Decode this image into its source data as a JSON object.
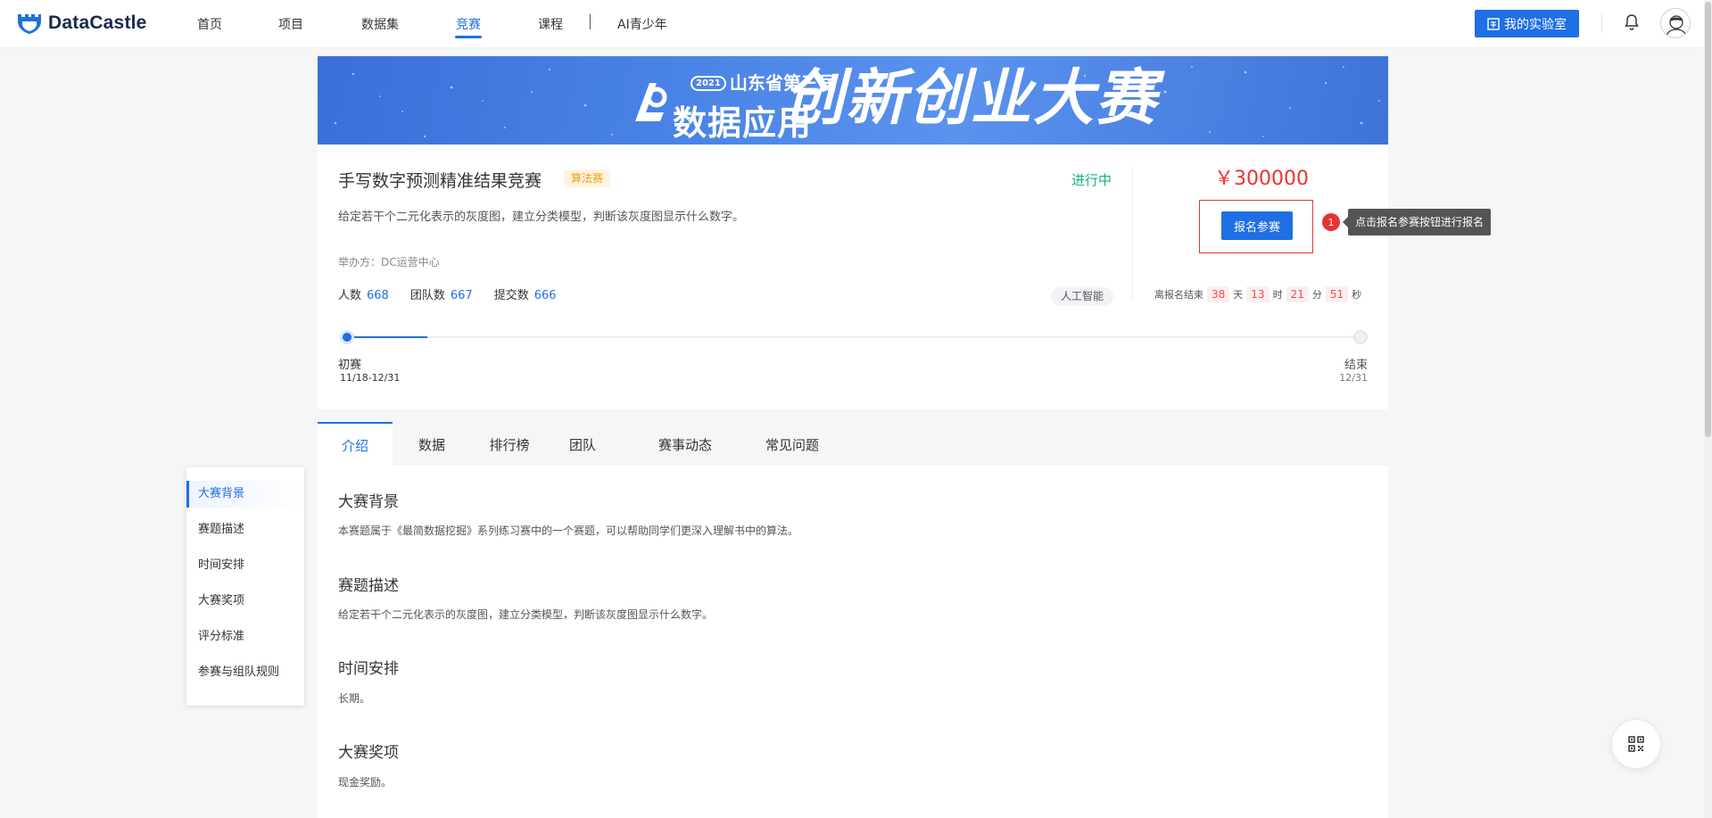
{
  "header": {
    "brand": "DataCastle",
    "nav": [
      {
        "label": "首页"
      },
      {
        "label": "项目"
      },
      {
        "label": "数据集"
      },
      {
        "label": "竞赛"
      },
      {
        "label": "课程"
      },
      {
        "label": "AI青少年"
      }
    ],
    "active_nav": "竞赛",
    "lab_button": "我的实验室"
  },
  "banner": {
    "year": "2021",
    "line1": "山东省第三届",
    "line2": "数据应用",
    "headline": "创新创业大赛"
  },
  "competition": {
    "title": "手写数字预测精准结果竞赛",
    "type_badge": "算法赛",
    "status": "进行中",
    "description": "给定若干个二元化表示的灰度图，建立分类模型，判断该灰度图显示什么数字。",
    "organizer": "举办方：DC运营中心",
    "stats": [
      {
        "label": "人数",
        "value": "668"
      },
      {
        "label": "团队数",
        "value": "667"
      },
      {
        "label": "提交数",
        "value": "666"
      }
    ],
    "tag": "人工智能",
    "prize": "￥300000",
    "signup_button": "报名参赛",
    "step_number": "1",
    "tooltip": "点击报名参赛按钮进行报名",
    "countdown": {
      "prefix": "离报名结束",
      "days": "38",
      "days_unit": "天",
      "hours": "13",
      "hours_unit": "时",
      "minutes": "21",
      "minutes_unit": "分",
      "seconds": "51",
      "seconds_unit": "秒"
    },
    "timeline": {
      "progress": 0.08,
      "start": {
        "name": "初赛",
        "date": "11/18-12/31"
      },
      "end": {
        "name": "结束",
        "date": "12/31"
      }
    }
  },
  "tabs": [
    {
      "label": "介绍"
    },
    {
      "label": "数据"
    },
    {
      "label": "排行榜"
    },
    {
      "label": "团队"
    },
    {
      "label": "赛事动态"
    },
    {
      "label": "常见问题"
    }
  ],
  "active_tab": "介绍",
  "side_nav": [
    {
      "label": "大赛背景"
    },
    {
      "label": "赛题描述"
    },
    {
      "label": "时间安排"
    },
    {
      "label": "大赛奖项"
    },
    {
      "label": "评分标准"
    },
    {
      "label": "参赛与组队规则"
    }
  ],
  "sections": [
    {
      "title": "大赛背景",
      "text": "本赛题属于《最简数据挖掘》系列练习赛中的一个赛题，可以帮助同学们更深入理解书中的算法。"
    },
    {
      "title": "赛题描述",
      "text": "给定若干个二元化表示的灰度图，建立分类模型，判断该灰度图显示什么数字。"
    },
    {
      "title": "时间安排",
      "text": "长期。"
    },
    {
      "title": "大赛奖项",
      "text": "现金奖励。"
    }
  ],
  "colors": {
    "primary": "#1f6fe5",
    "prize": "#f0332a",
    "status": "#16b37a",
    "badge": "#f39a1a"
  }
}
